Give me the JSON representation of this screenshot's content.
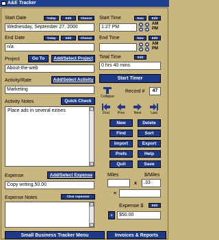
{
  "window": {
    "title": "A&E Tracker"
  },
  "start_date": {
    "label": "Start Date",
    "value": "Wednesday, September 27, 2000",
    "today": "Today",
    "edit": "Edit",
    "choose": "Choose"
  },
  "end_date": {
    "label": "End Date",
    "value": "n/a",
    "today": "Today",
    "edit": "Edit",
    "choose": "Choose"
  },
  "project": {
    "label": "Project",
    "goto": "Go To",
    "add": "Add/Select Project",
    "value": "About-the-web"
  },
  "activity": {
    "label": "Activity/Rate",
    "add": "Add/Select Activity",
    "value": "Marketing"
  },
  "activity_notes": {
    "label": "Activity Notes",
    "quick_check": "Quick Check",
    "value": "Place ads in several ezines"
  },
  "expense": {
    "label": "Expense",
    "add": "Add/Select Expense",
    "value": "Copy writing,50.00"
  },
  "expense_notes": {
    "label": "Expense Notes",
    "clear": "Clear expenses",
    "value": ""
  },
  "start_time": {
    "label": "Start Time",
    "now": "Now",
    "edit": "Edit",
    "value": "1:27 PM",
    "ampm": "AM\nPM"
  },
  "end_time": {
    "label": "End Time",
    "now": "Now",
    "edit": "Edit",
    "value": "",
    "ampm": "AM\nPM"
  },
  "total_time": {
    "label": "Total Time",
    "edit": "Edit",
    "value": "0 hrs 40 mins"
  },
  "timer": {
    "start_label": "Start Timer",
    "collapse_label": "Collapse"
  },
  "record": {
    "label": "Record #",
    "value": "47"
  },
  "nav": {
    "first": "First",
    "prev": "Prev",
    "next": "Next",
    "last": "Last"
  },
  "actions": {
    "new": "New",
    "delete": "Delete",
    "find": "Find",
    "sort": "Sort",
    "import": "Import",
    "export": "Export",
    "prefs": "Prefs",
    "help": "Help",
    "quit": "Quit",
    "save": "Save"
  },
  "miles": {
    "label": "Miles",
    "per_label": "$/Miles",
    "x": "x",
    "eq": "=",
    "miles_value": "",
    "rate_value": ".33",
    "result_value": ""
  },
  "expense_total": {
    "label": "Expense $",
    "edit": "Edit",
    "plus": "+",
    "value": "$50.00"
  },
  "bottom": {
    "menu": "Small Business Tracker Menu",
    "reports": "Invoices & Reports"
  },
  "colors": {
    "background": "#c9b57e",
    "button": "#1d3a8a",
    "titlebar": "#1e3f8c"
  },
  "icons": [
    "app-icon",
    "collapse-icon",
    "first-icon",
    "prev-icon",
    "next-icon",
    "last-icon",
    "spin-up-icon",
    "spin-down-icon",
    "scroll-arrow-icon"
  ]
}
